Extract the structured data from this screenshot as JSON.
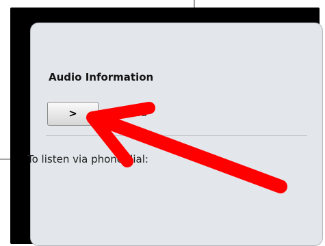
{
  "audio_panel": {
    "title": "Audio Information",
    "play_button_label": ">",
    "status": "Muted",
    "dial_instructions": "To listen via phone dial:"
  },
  "annotation": {
    "arrow_color": "#ff0000",
    "arrow_points_to": "play-button"
  },
  "colors": {
    "panel_background": "#e3e6ea",
    "frame": "#000000"
  }
}
